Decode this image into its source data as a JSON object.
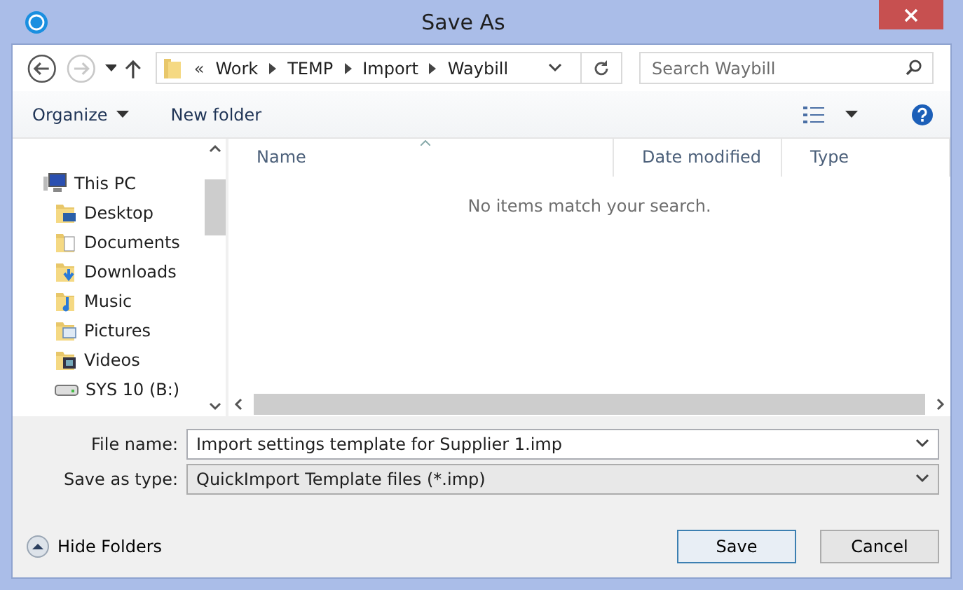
{
  "window": {
    "title": "Save As"
  },
  "address_bar": {
    "prefix": "«",
    "crumbs": [
      "Work",
      "TEMP",
      "Import",
      "Waybill"
    ]
  },
  "search": {
    "placeholder": "Search Waybill"
  },
  "toolbar": {
    "buttons": [
      {
        "label": "Organize",
        "dropdown": true
      },
      {
        "label": "New folder",
        "dropdown": false
      }
    ]
  },
  "tree": {
    "items": [
      {
        "label": "This PC",
        "kind": "pc",
        "children": [
          {
            "label": "Desktop",
            "kind": "desktop"
          },
          {
            "label": "Documents",
            "kind": "documents"
          },
          {
            "label": "Downloads",
            "kind": "downloads"
          },
          {
            "label": "Music",
            "kind": "music"
          },
          {
            "label": "Pictures",
            "kind": "pictures"
          },
          {
            "label": "Videos",
            "kind": "videos"
          },
          {
            "label": "SYS 10 (B:)",
            "kind": "drive"
          }
        ]
      }
    ]
  },
  "file_list": {
    "columns": [
      {
        "label": "Name",
        "sorted": true
      },
      {
        "label": "Date modified",
        "sorted": false
      },
      {
        "label": "Type",
        "sorted": false
      }
    ],
    "empty_message": "No items match your search."
  },
  "form": {
    "fields": [
      {
        "label": "File name:",
        "value": "Import settings template for Supplier 1.imp",
        "kind": "editable"
      },
      {
        "label": "Save as type:",
        "value": "QuickImport Template files (*.imp)",
        "kind": "dropdown"
      }
    ]
  },
  "hide_folders": "Hide Folders",
  "buttons": [
    {
      "label": "Save",
      "default": true
    },
    {
      "label": "Cancel",
      "default": false
    }
  ]
}
